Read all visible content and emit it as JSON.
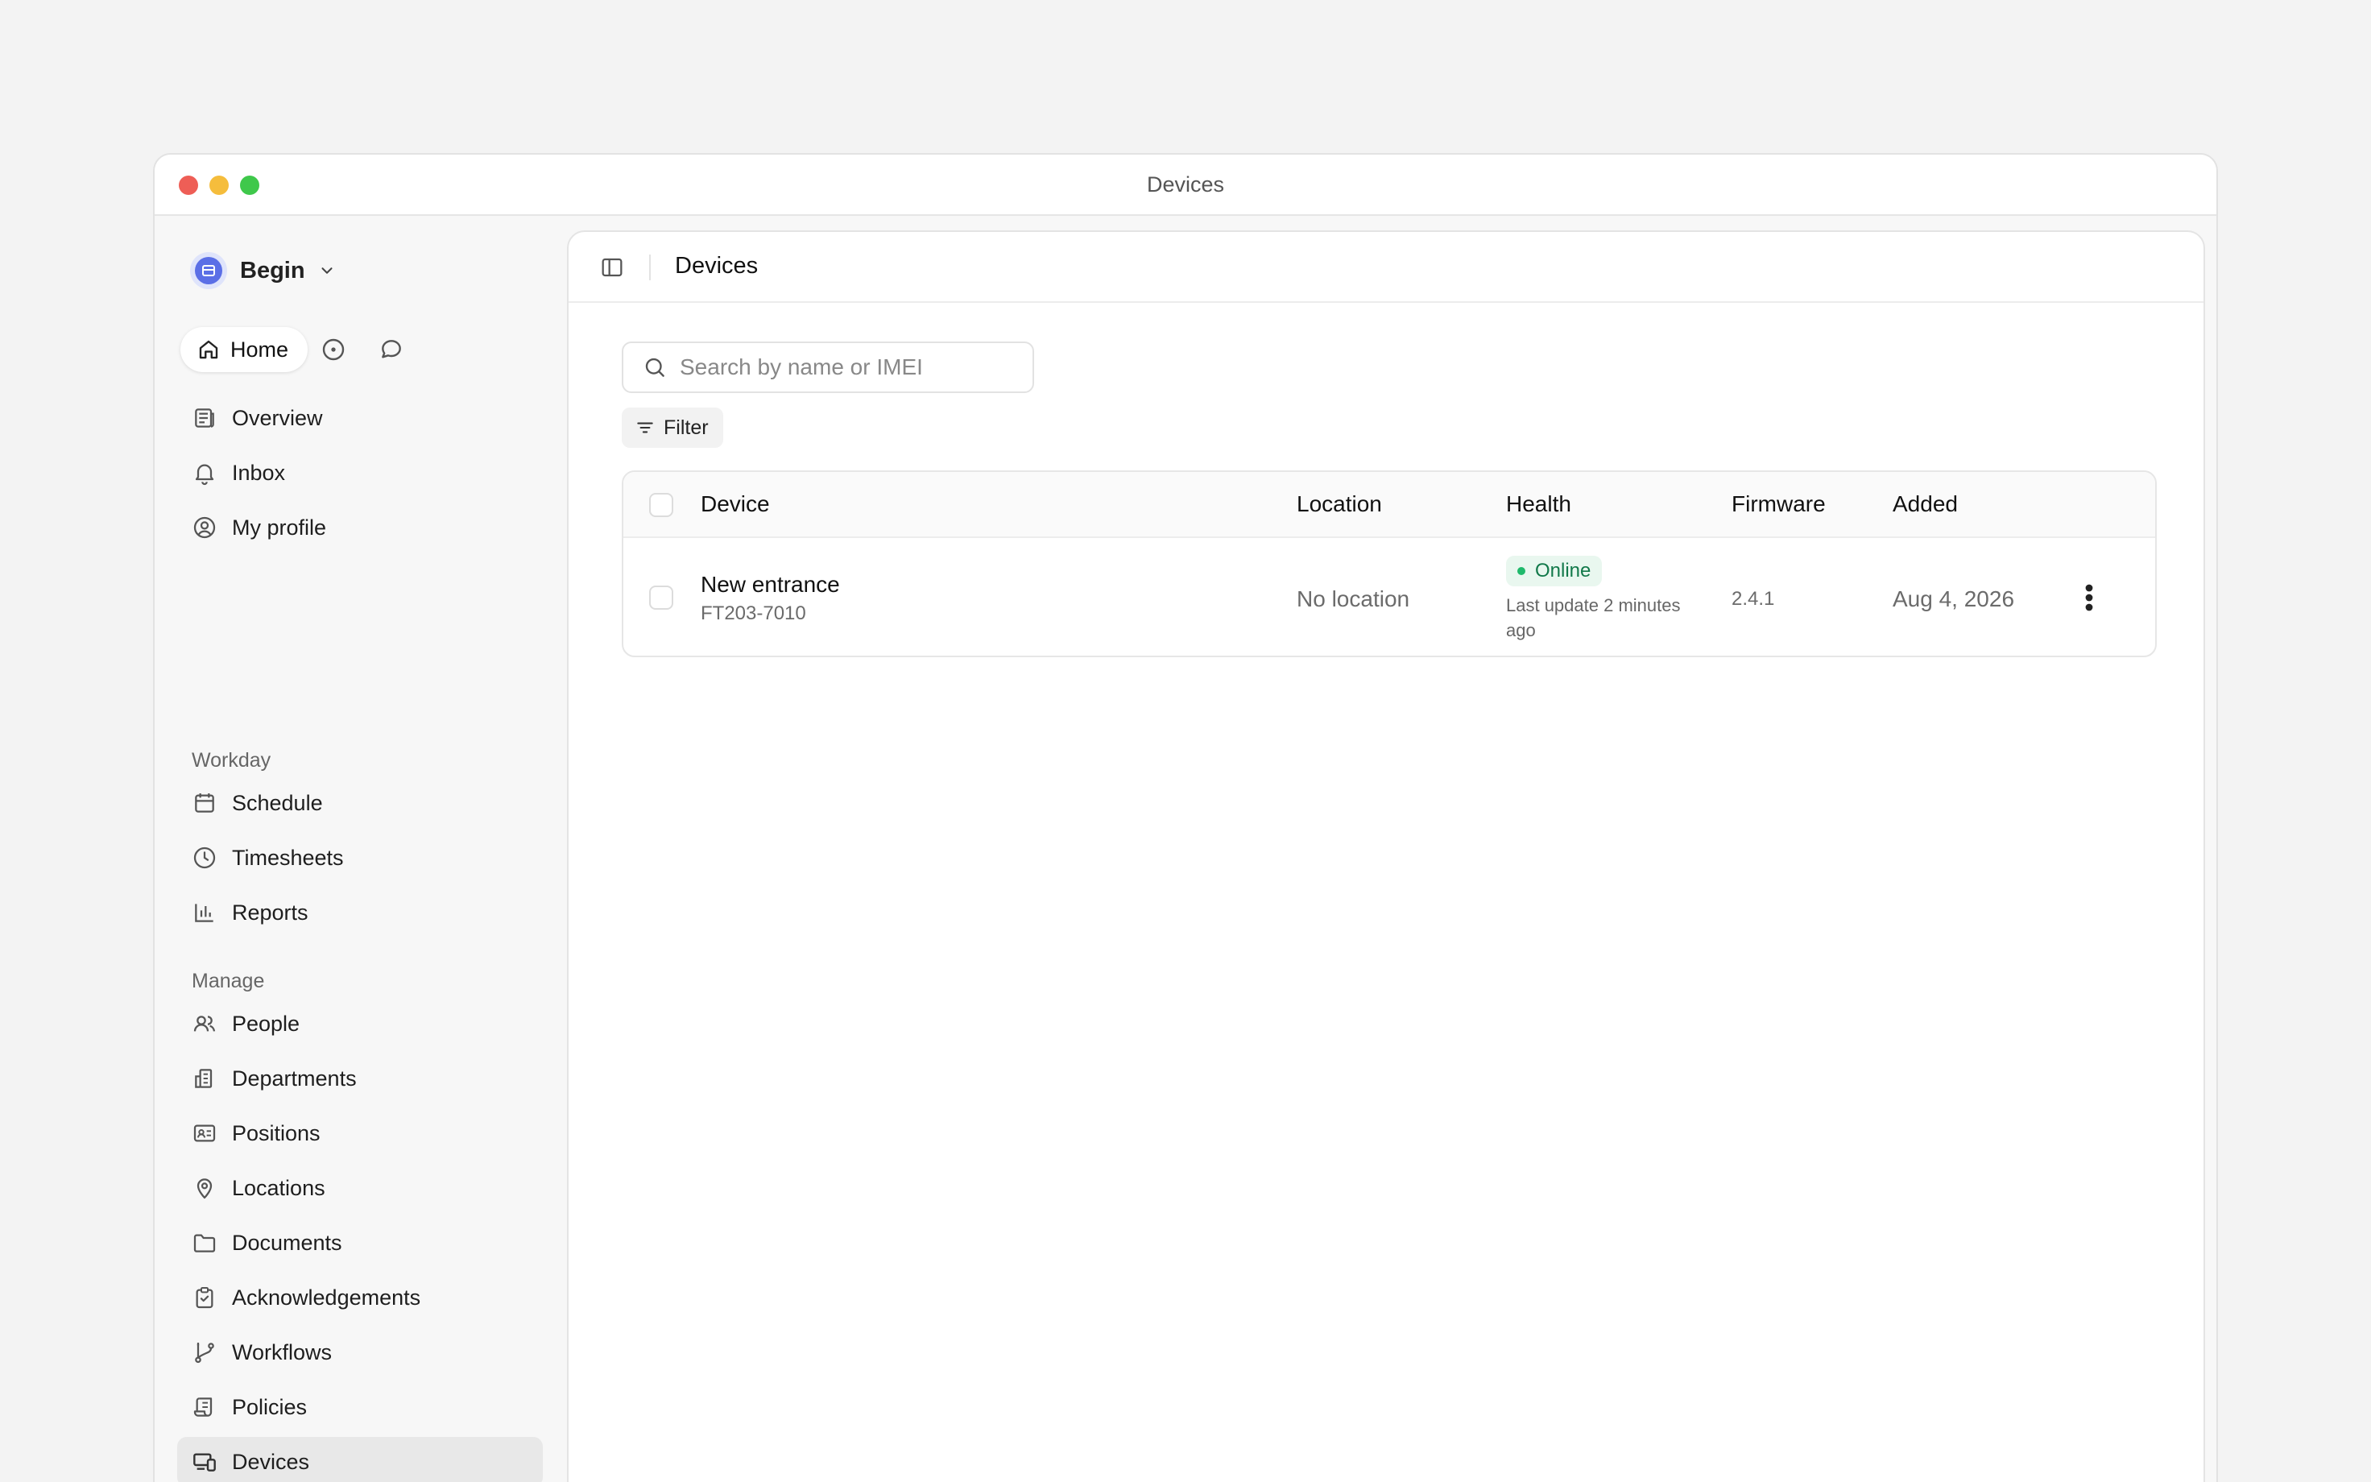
{
  "window": {
    "title": "Devices"
  },
  "sidebar": {
    "workspace_name": "Begin",
    "home_label": "Home",
    "primary": [
      {
        "label": "Overview",
        "icon": "newspaper-icon"
      },
      {
        "label": "Inbox",
        "icon": "bell-icon"
      },
      {
        "label": "My profile",
        "icon": "user-circle-icon"
      }
    ],
    "workday_label": "Workday",
    "workday": [
      {
        "label": "Schedule",
        "icon": "calendar-icon"
      },
      {
        "label": "Timesheets",
        "icon": "clock-icon"
      },
      {
        "label": "Reports",
        "icon": "bar-chart-icon"
      }
    ],
    "manage_label": "Manage",
    "manage": [
      {
        "label": "People",
        "icon": "users-icon"
      },
      {
        "label": "Departments",
        "icon": "building-icon"
      },
      {
        "label": "Positions",
        "icon": "id-card-icon"
      },
      {
        "label": "Locations",
        "icon": "map-pin-icon"
      },
      {
        "label": "Documents",
        "icon": "folder-icon"
      },
      {
        "label": "Acknowledgements",
        "icon": "clipboard-check-icon"
      },
      {
        "label": "Workflows",
        "icon": "git-branch-icon"
      },
      {
        "label": "Policies",
        "icon": "scroll-icon"
      },
      {
        "label": "Devices",
        "icon": "devices-icon",
        "active": true
      }
    ]
  },
  "main": {
    "title": "Devices",
    "search": {
      "placeholder": "Search by name or IMEI",
      "value": ""
    },
    "filter_label": "Filter",
    "table": {
      "columns": [
        "Device",
        "Location",
        "Health",
        "Firmware",
        "Added"
      ],
      "rows": [
        {
          "name": "New entrance",
          "id": "FT203-7010",
          "location": "No location",
          "health": "Online",
          "health_note": "Last update 2 minutes ago",
          "firmware": "2.4.1",
          "added": "Aug 4, 2026"
        }
      ]
    }
  },
  "colors": {
    "accent": "#5b6fe6",
    "online_badge_bg": "#e9f7ef",
    "online_text": "#12794a",
    "online_dot": "#1fb96b"
  }
}
